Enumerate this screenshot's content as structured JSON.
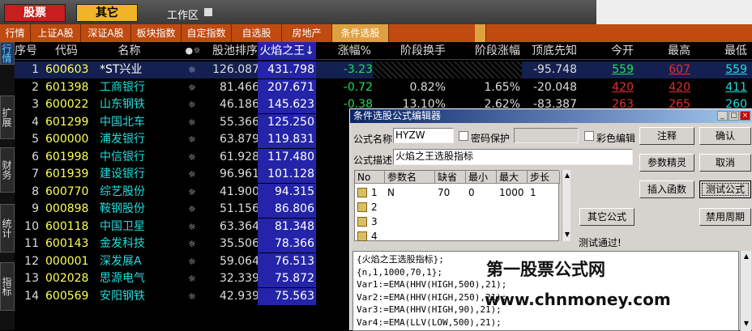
{
  "top": {
    "stock_btn": "股票",
    "other_btn": "其它",
    "workspace": "工作区"
  },
  "tabs": [
    "行情",
    "上证A股",
    "深证A股",
    "板块指数",
    "自定指数",
    "自选股",
    "房地产",
    "条件选股"
  ],
  "sidetabs": [
    "行情",
    "扩展",
    "财务",
    "统计",
    "指标"
  ],
  "headers": [
    "序号",
    "代码",
    "名称",
    "股池排序",
    "火焰之王↓",
    "涨幅%",
    "阶段换手",
    "阶段涨幅",
    "顶底先知",
    "今开",
    "最高",
    "最低"
  ],
  "header_icons": "●☼",
  "rows": [
    {
      "idx": "1",
      "code": "600603",
      "name": "*ST兴业",
      "pool": "126.087",
      "fire": "431.798",
      "chg": "-3.23",
      "turn": "",
      "stage": "",
      "tops": "-95.748",
      "open": "559",
      "high": "607",
      "low": "559",
      "dir": "neg"
    },
    {
      "idx": "2",
      "code": "601398",
      "name": "工商银行",
      "pool": "81.466",
      "fire": "207.671",
      "chg": "-0.72",
      "turn": "0.82%",
      "stage": "1.65%",
      "tops": "-20.048",
      "open": "420",
      "high": "420",
      "low": "411",
      "dir": "neg"
    },
    {
      "idx": "3",
      "code": "600022",
      "name": "山东钢铁",
      "pool": "46.186",
      "fire": "145.623",
      "chg": "-0.38",
      "turn": "13.10%",
      "stage": "2.62%",
      "tops": "-83.387",
      "open": "263",
      "high": "265",
      "low": "260",
      "dir": "neg"
    },
    {
      "idx": "4",
      "code": "601299",
      "name": "中国北车",
      "pool": "55.366",
      "fire": "125.250",
      "chg": "",
      "turn": "",
      "stage": "",
      "tops": "",
      "open": "",
      "high": "",
      "low": "",
      "dir": "neg"
    },
    {
      "idx": "5",
      "code": "600000",
      "name": "浦发银行",
      "pool": "63.879",
      "fire": "119.831",
      "chg": "",
      "turn": "",
      "stage": "",
      "tops": "",
      "open": "",
      "high": "",
      "low": "",
      "dir": "neg"
    },
    {
      "idx": "6",
      "code": "601998",
      "name": "中信银行",
      "pool": "61.928",
      "fire": "117.480",
      "chg": "",
      "turn": "",
      "stage": "",
      "tops": "",
      "open": "",
      "high": "",
      "low": "",
      "dir": "neg"
    },
    {
      "idx": "7",
      "code": "601939",
      "name": "建设银行",
      "pool": "96.961",
      "fire": "101.128",
      "chg": "",
      "turn": "",
      "stage": "",
      "tops": "",
      "open": "",
      "high": "",
      "low": "",
      "dir": "neg"
    },
    {
      "idx": "8",
      "code": "600770",
      "name": "综艺股份",
      "pool": "41.900",
      "fire": "94.315",
      "chg": "",
      "turn": "",
      "stage": "",
      "tops": "",
      "open": "",
      "high": "",
      "low": "",
      "dir": "neg"
    },
    {
      "idx": "9",
      "code": "000898",
      "name": "鞍钢股份",
      "pool": "51.156",
      "fire": "86.806",
      "chg": "",
      "turn": "",
      "stage": "",
      "tops": "",
      "open": "",
      "high": "",
      "low": "",
      "dir": "neg"
    },
    {
      "idx": "10",
      "code": "600118",
      "name": "中国卫星",
      "pool": "63.364",
      "fire": "81.348",
      "chg": "",
      "turn": "",
      "stage": "",
      "tops": "",
      "open": "",
      "high": "",
      "low": "",
      "dir": "neg"
    },
    {
      "idx": "11",
      "code": "600143",
      "name": "金发科技",
      "pool": "35.506",
      "fire": "78.366",
      "chg": "",
      "turn": "",
      "stage": "",
      "tops": "",
      "open": "",
      "high": "",
      "low": "",
      "dir": "neg"
    },
    {
      "idx": "12",
      "code": "000001",
      "name": "深发展A",
      "pool": "59.064",
      "fire": "76.513",
      "chg": "",
      "turn": "",
      "stage": "",
      "tops": "",
      "open": "",
      "high": "",
      "low": "",
      "dir": "neg"
    },
    {
      "idx": "13",
      "code": "002028",
      "name": "思源电气",
      "pool": "32.339",
      "fire": "75.872",
      "chg": "",
      "turn": "",
      "stage": "",
      "tops": "",
      "open": "",
      "high": "",
      "low": "",
      "dir": "neg"
    },
    {
      "idx": "14",
      "code": "600569",
      "name": "安阳钢铁",
      "pool": "42.939",
      "fire": "75.563",
      "chg": "",
      "turn": "",
      "stage": "",
      "tops": "",
      "open": "",
      "high": "",
      "low": "",
      "dir": "neg"
    }
  ],
  "dialog": {
    "title": "条件选股公式编辑器",
    "formula_name_label": "公式名称",
    "formula_name": "HYZW",
    "password_label": "密码保护",
    "color_label": "彩色编辑",
    "desc_label": "公式描述",
    "desc": "火焰之王选股指标",
    "buttons": {
      "note": "注释",
      "ok": "确认",
      "param": "参数精灵",
      "cancel": "取消",
      "insert": "插入函数",
      "test": "测试公式",
      "other": "其它公式",
      "disable": "禁用周期"
    },
    "param_headers": [
      "No",
      "参数名",
      "缺省",
      "最小",
      "最大",
      "步长"
    ],
    "params": [
      {
        "no": "1",
        "name": "N",
        "def": "70",
        "min": "0",
        "max": "1000",
        "step": "1"
      },
      {
        "no": "2",
        "name": "",
        "def": "",
        "min": "",
        "max": "",
        "step": ""
      },
      {
        "no": "3",
        "name": "",
        "def": "",
        "min": "",
        "max": "",
        "step": ""
      },
      {
        "no": "4",
        "name": "",
        "def": "",
        "min": "",
        "max": "",
        "step": ""
      }
    ],
    "status": "测试通过!",
    "code": [
      "{火焰之王选股指标};",
      "{n,1,1000,70,1};",
      "Var1:=EMA(HHV(HIGH,500),21);",
      "Var2:=EMA(HHV(HIGH,250),21);",
      "Var3:=EMA(HHV(HIGH,90),21);",
      "Var4:=EMA(LLV(LOW,500),21);"
    ]
  },
  "watermark": {
    "line1": "第一股票公式网",
    "line2": "www.chnmoney.com"
  }
}
